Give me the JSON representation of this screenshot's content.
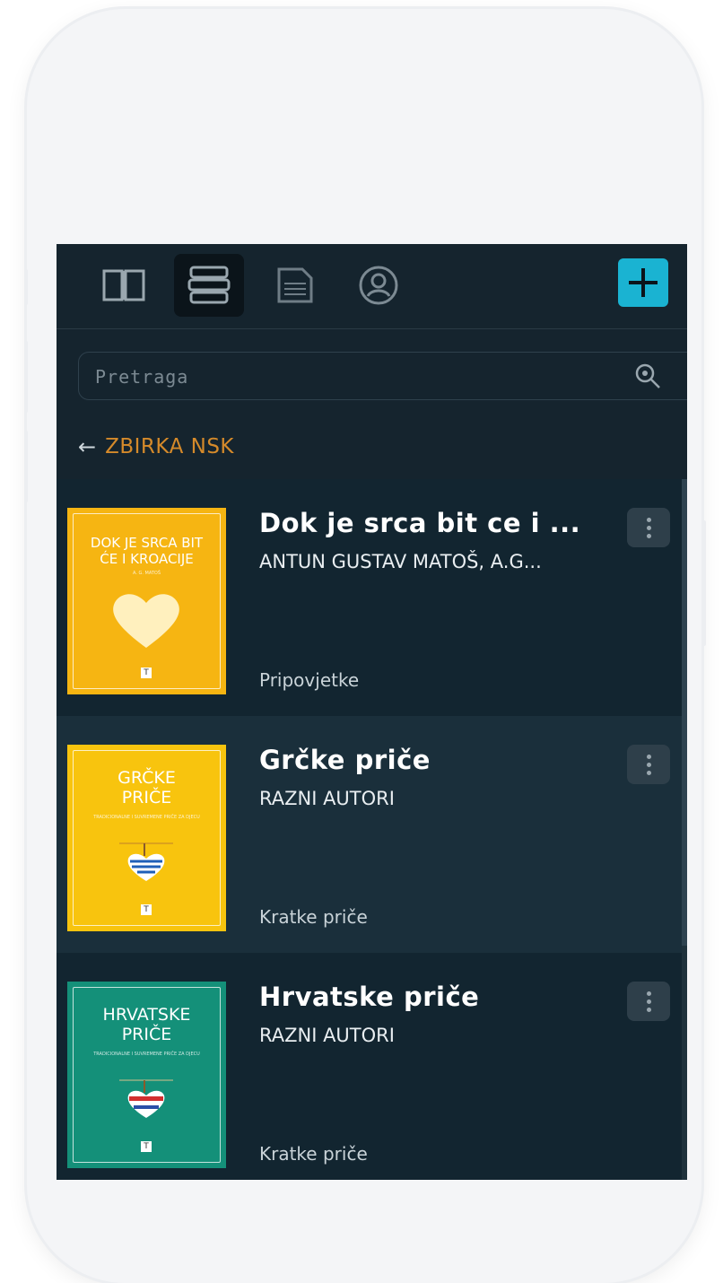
{
  "app": {
    "nav": {
      "tabs": [
        {
          "icon": "open-book-icon",
          "active": false
        },
        {
          "icon": "library-stack-icon",
          "active": true
        },
        {
          "icon": "document-icon",
          "active": false
        },
        {
          "icon": "user-profile-icon",
          "active": false
        }
      ],
      "add_icon": "plus-icon"
    },
    "search": {
      "placeholder": "Pretraga",
      "icon": "search-icon"
    },
    "breadcrumb": {
      "arrow": "←",
      "label": "ZBIRKA NSK"
    },
    "books": [
      {
        "title": "Dok je srca bit ce i ...",
        "author": "ANTUN GUSTAV MATOŠ, A.G...",
        "genre": "Pripovjetke",
        "cover": {
          "color": "#f6b512",
          "title_line1": "DOK JE SRCA BIT",
          "title_line2": "ĆE I KROACIJE",
          "subtitle": "A. G. MATOŠ"
        }
      },
      {
        "title": "Grčke priče",
        "author": "RAZNI AUTORI",
        "genre": "Kratke priče",
        "cover": {
          "color": "#f8c40e",
          "title_line1": "GRČKE",
          "title_line2": "PRIČE",
          "subtitle": "TRADICIONALNE I SUVREMENE PRIČE ZA DJECU"
        }
      },
      {
        "title": "Hrvatske priče",
        "author": "RAZNI AUTORI",
        "genre": "Kratke priče",
        "cover": {
          "color": "#149079",
          "title_line1": "HRVATSKE",
          "title_line2": "PRIČE",
          "subtitle": "TRADICIONALNE I SUVREMENE PRIČE ZA DJECU"
        }
      }
    ],
    "colors": {
      "background": "#15242e",
      "accent": "#1ab3d2",
      "breadcrumb": "#d58a2a"
    }
  }
}
